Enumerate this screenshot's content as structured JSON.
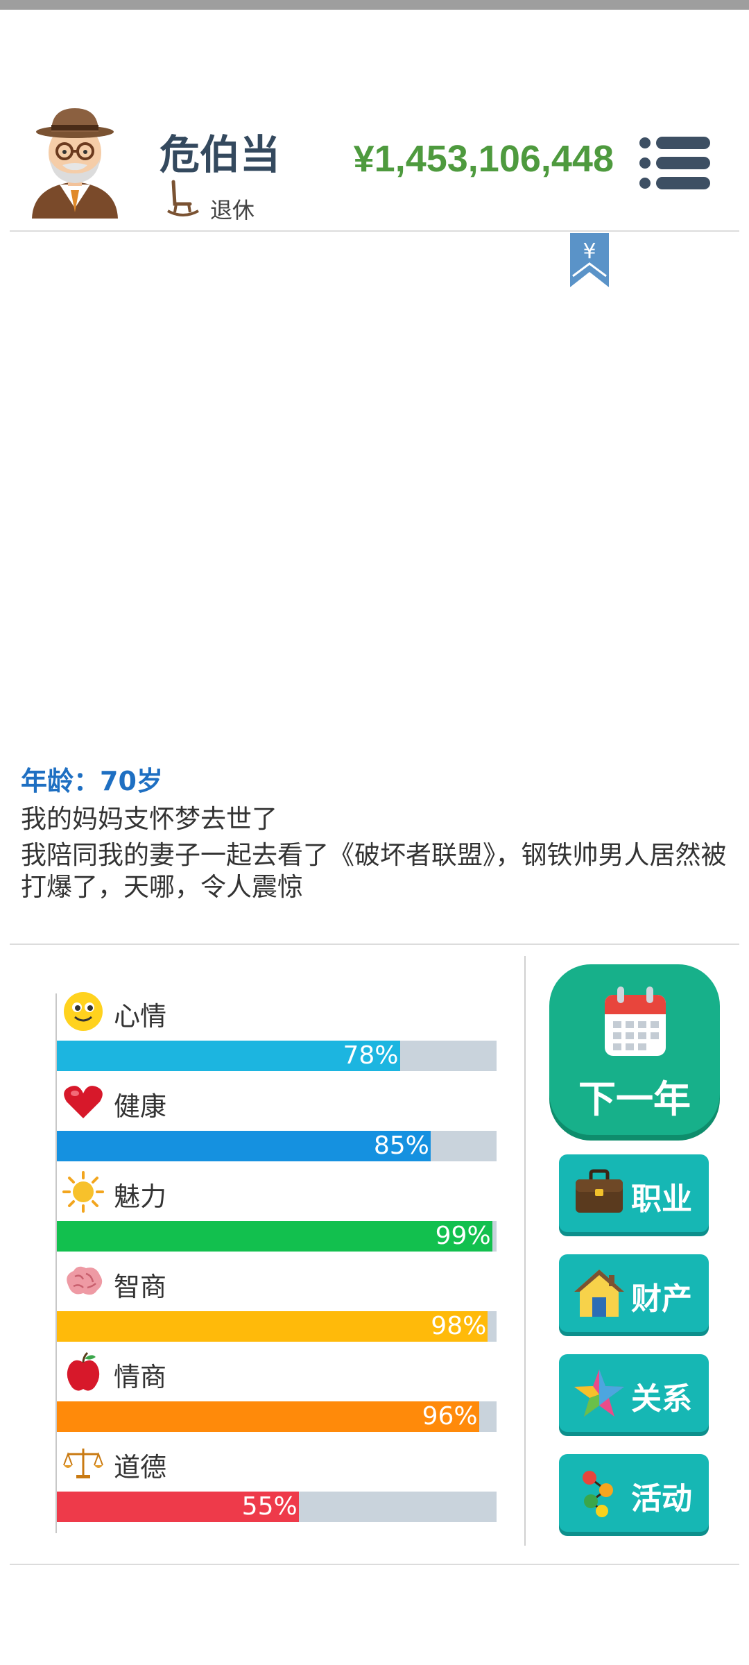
{
  "player": {
    "name": "危伯当",
    "status": "退休",
    "money": "¥1,453,106,448"
  },
  "bookmark": {
    "symbol": "¥"
  },
  "log": {
    "age": "年龄：70岁",
    "events": [
      "我的妈妈支怀梦去世了",
      "我陪同我的妻子一起去看了《破坏者联盟》，钢铁帅男人居然被打爆了，天哪，令人震惊"
    ]
  },
  "stats": [
    {
      "label": "心情",
      "value": 78,
      "pct": "78%",
      "color": "#1cb5e0",
      "icon": "smiley-face-icon"
    },
    {
      "label": "健康",
      "value": 85,
      "pct": "85%",
      "color": "#1591e0",
      "icon": "heart-icon"
    },
    {
      "label": "魅力",
      "value": 99,
      "pct": "99%",
      "color": "#12c04e",
      "icon": "sun-icon"
    },
    {
      "label": "智商",
      "value": 98,
      "pct": "98%",
      "color": "#ffba0a",
      "icon": "brain-icon"
    },
    {
      "label": "情商",
      "value": 96,
      "pct": "96%",
      "color": "#ff8a0a",
      "icon": "apple-icon"
    },
    {
      "label": "道德",
      "value": 55,
      "pct": "55%",
      "color": "#ee3a4a",
      "icon": "scales-icon"
    }
  ],
  "buttons": {
    "next_year": "下一年",
    "career": "职业",
    "assets": "财产",
    "relations": "关系",
    "activities": "活动"
  },
  "colors": {
    "money": "#4e9a3e",
    "age_text": "#1e6fc2",
    "next_year_button": "#17b08a",
    "side_button": "#16b7b4"
  }
}
